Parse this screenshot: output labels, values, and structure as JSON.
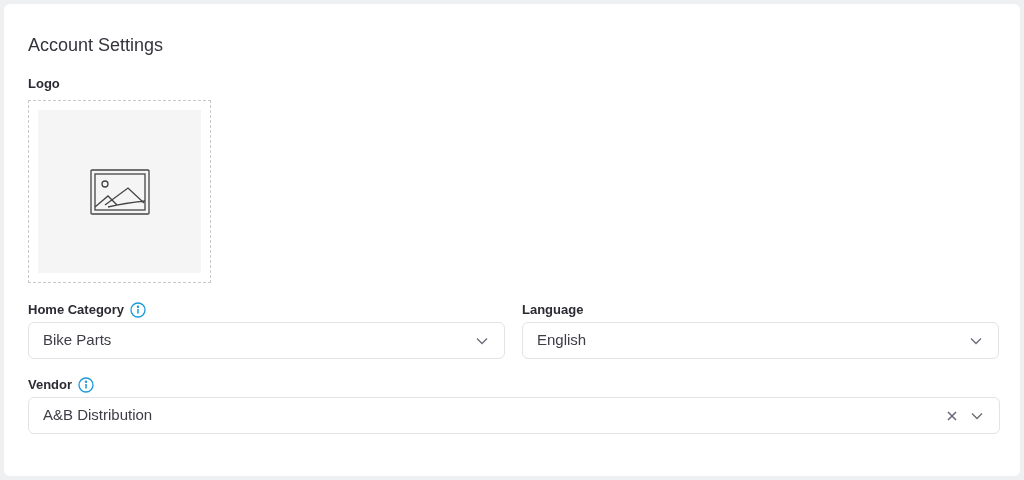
{
  "card": {
    "title": "Account Settings"
  },
  "logo": {
    "label": "Logo"
  },
  "field_rows": [
    [
      {
        "label": "Home Category",
        "info": true,
        "value": "Bike Parts",
        "clearable": false
      },
      {
        "label": "Language",
        "info": false,
        "value": "English",
        "clearable": false
      }
    ],
    [
      {
        "label": "Vendor",
        "info": true,
        "value": "A&B Distribution",
        "clearable": true
      }
    ]
  ]
}
